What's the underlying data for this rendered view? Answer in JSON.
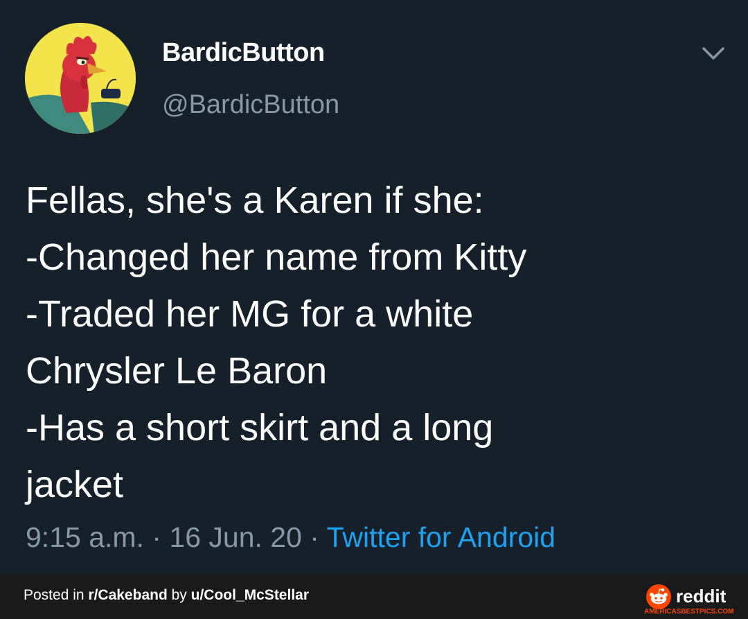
{
  "tweet": {
    "display_name": "BardicButton",
    "handle": "@BardicButton",
    "text_lines": [
      "Fellas, she's a Karen if she:",
      "-Changed her name from Kitty",
      "-Traded her MG for a white",
      "Chrysler Le Baron",
      "-Has a short skirt and a long",
      "jacket"
    ],
    "time": "9:15 a.m.",
    "separator": "·",
    "date": "16 Jun. 20",
    "source": "Twitter for Android",
    "avatar_icon": "rooster-avatar",
    "menu_icon": "chevron-down-icon",
    "colors": {
      "background": "#15202b",
      "muted": "#8899a6",
      "link": "#1da1f2"
    }
  },
  "footer": {
    "posted_prefix": "Posted in ",
    "subreddit": "r/Cakeband",
    "by": " by ",
    "user": "u/Cool_McStellar",
    "brand": "reddit",
    "watermark": "AMERICASBESTPICS.COM",
    "colors": {
      "background": "#1a1a1b",
      "brand": "#ff4500"
    }
  }
}
